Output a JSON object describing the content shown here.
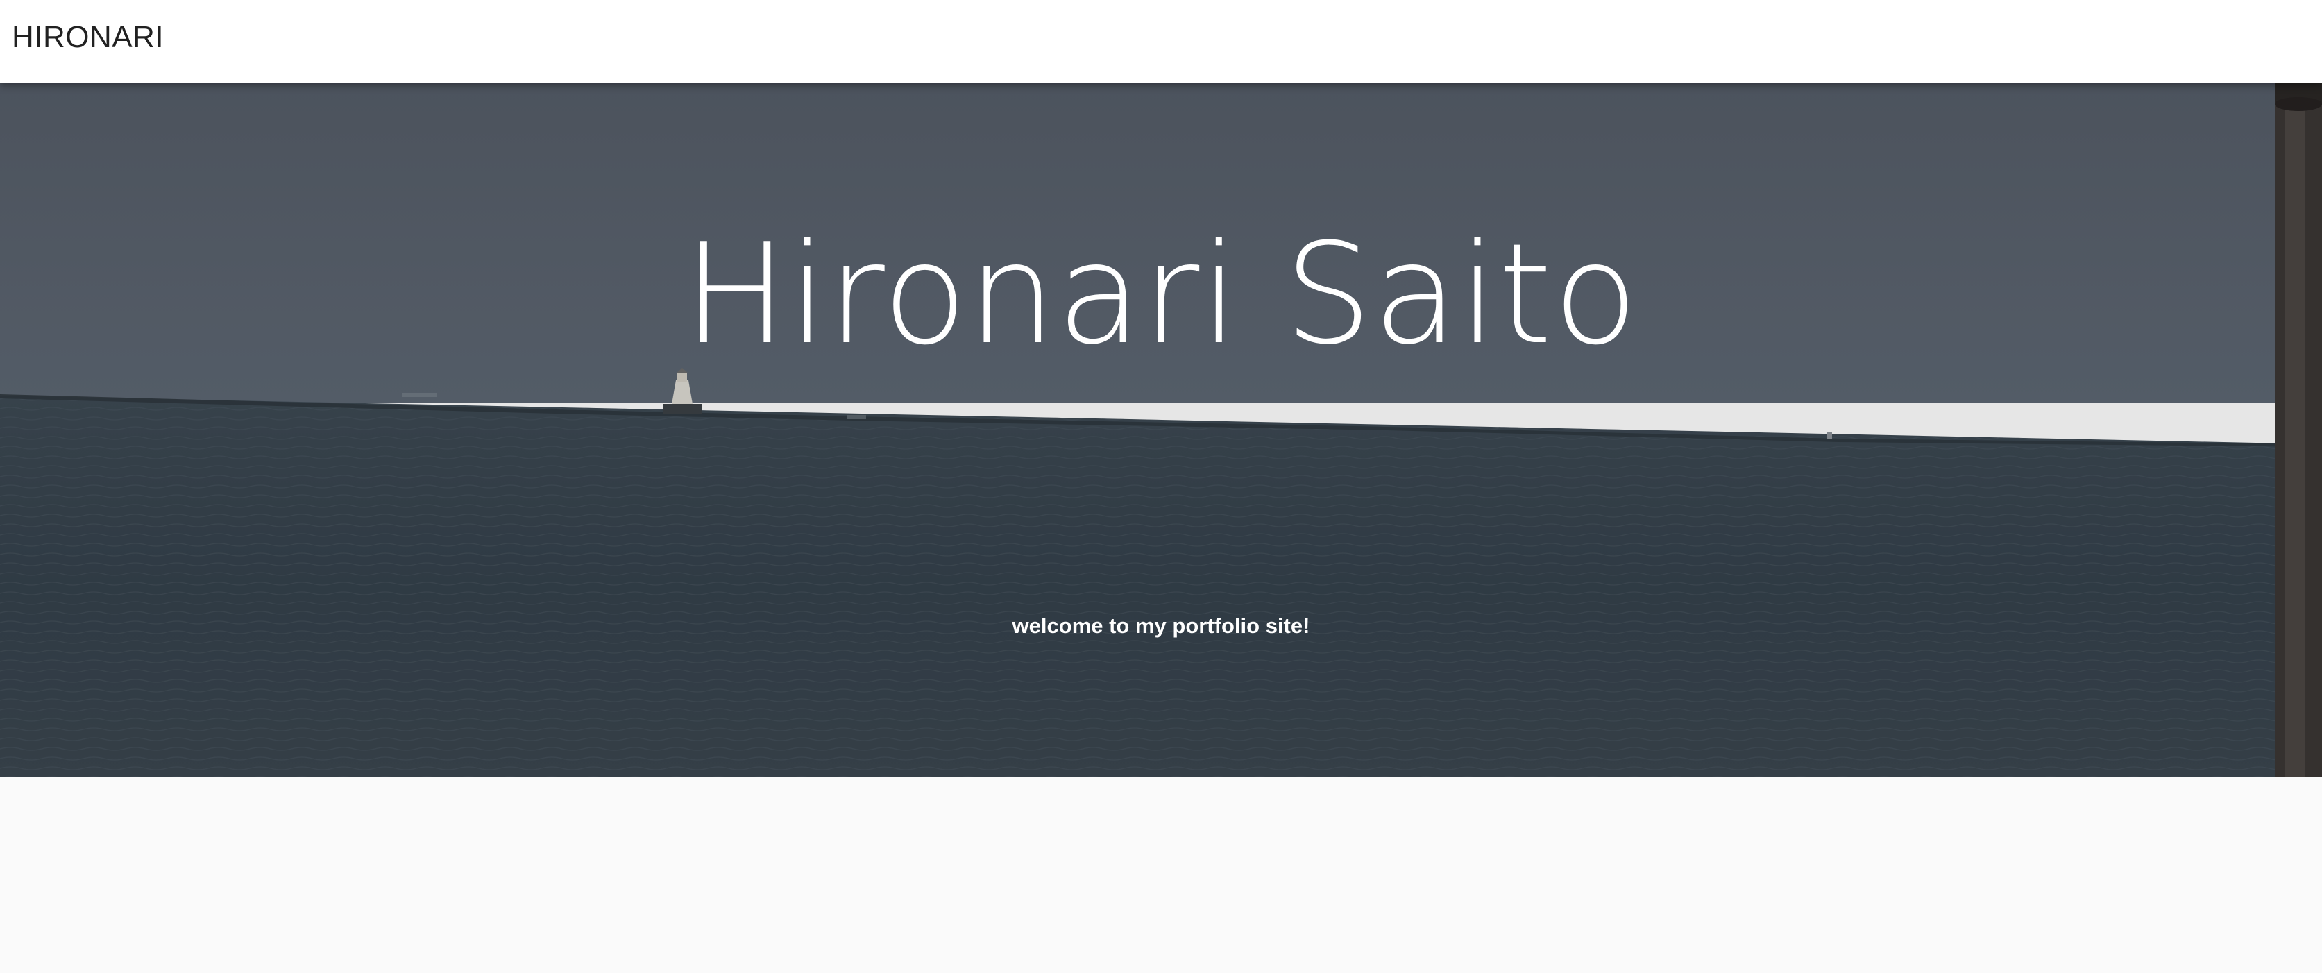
{
  "app_bar": {
    "brand": "HIRONARI"
  },
  "hero": {
    "title": "Hironari Saito",
    "subtitle": "welcome to my portfolio site!",
    "background_image": "lake-horizon-with-lighthouse",
    "colors": {
      "sky": "#565e69",
      "water": "#3a4650",
      "overlay_text": "#ffffff"
    }
  },
  "page": {
    "background": "#fafafa"
  }
}
